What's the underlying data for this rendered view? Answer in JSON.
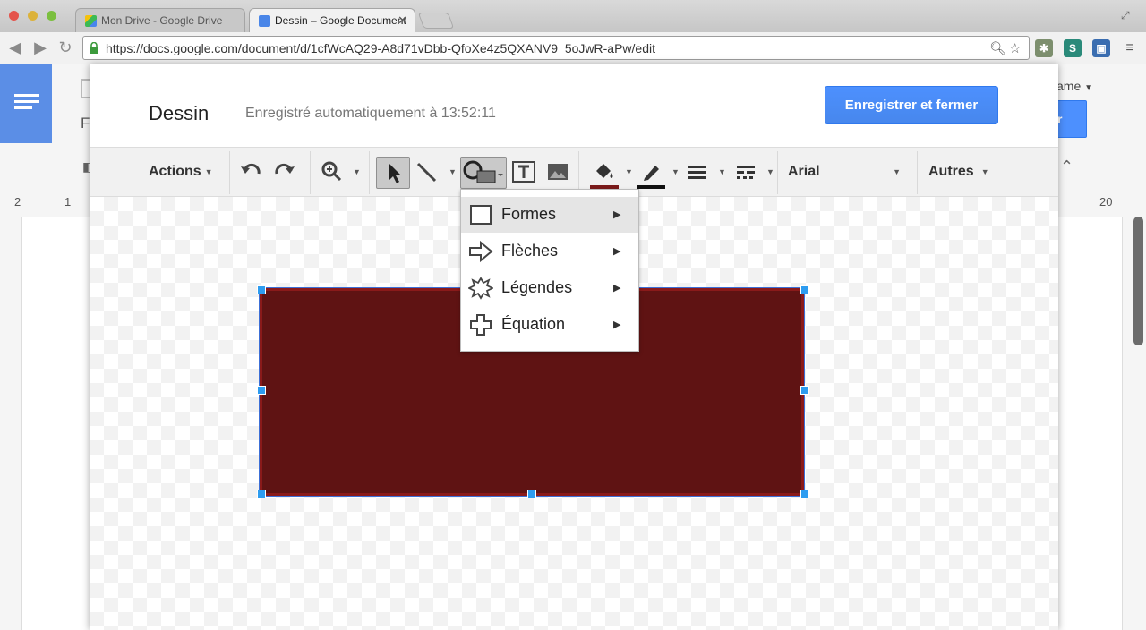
{
  "browser": {
    "tabs": [
      {
        "title": "Mon Drive - Google Drive",
        "active": false
      },
      {
        "title": "Dessin – Google Document",
        "active": true
      }
    ],
    "url": "https://docs.google.com/document/d/1cfWcAQ29-A8d71vDbb-QfoXe4z5QXANV9_5oJwR-aPw/edit",
    "extensions": [
      "S"
    ]
  },
  "background_doc": {
    "user_name_fragment": "ame",
    "share_fragment": "r",
    "ruler": {
      "left_ticks": [
        "2",
        "1"
      ],
      "right_ticks": [
        "20"
      ]
    }
  },
  "dialog": {
    "title": "Dessin",
    "status": "Enregistré automatiquement à 13:52:11",
    "save_close_label": "Enregistrer et fermer"
  },
  "toolbar": {
    "actions_label": "Actions",
    "font_name": "Arial",
    "more_label": "Autres",
    "fill_color": "#7a1b1b",
    "line_color": "#111111"
  },
  "shape_menu": {
    "items": [
      {
        "label": "Formes",
        "icon": "square-icon",
        "highlighted": true
      },
      {
        "label": "Flèches",
        "icon": "arrow-icon",
        "highlighted": false
      },
      {
        "label": "Légendes",
        "icon": "callout-icon",
        "highlighted": false
      },
      {
        "label": "Équation",
        "icon": "plus-icon",
        "highlighted": false
      }
    ]
  },
  "canvas": {
    "shape_fill": "#5f1313"
  }
}
